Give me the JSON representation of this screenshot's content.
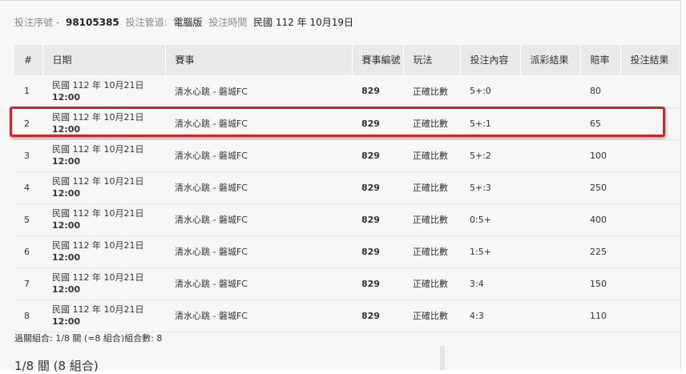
{
  "bet_info": {
    "serial_label": "投注序號 -",
    "serial_value": "98105385",
    "channel_label": "投注管道:",
    "channel_value": "電腦版",
    "time_label": "投注時間",
    "time_value": "民國 112 年 10月19日"
  },
  "table": {
    "headers": [
      "#",
      "日期",
      "賽事",
      "賽事編號",
      "玩法",
      "投注內容",
      "派彩結果",
      "賠率",
      "投注結果"
    ],
    "rows": [
      {
        "no": "1",
        "date": "民國 112 年 10月21日",
        "time": "12:00",
        "match": "清水心跳 - 磐城FC",
        "match_id": "829",
        "play": "正確比數",
        "selection": "5+:0",
        "payout": "",
        "odds": "80",
        "result": ""
      },
      {
        "no": "2",
        "date": "民國 112 年 10月21日",
        "time": "12:00",
        "match": "清水心跳 - 磐城FC",
        "match_id": "829",
        "play": "正確比數",
        "selection": "5+:1",
        "payout": "",
        "odds": "65",
        "result": ""
      },
      {
        "no": "3",
        "date": "民國 112 年 10月21日",
        "time": "12:00",
        "match": "清水心跳 - 磐城FC",
        "match_id": "829",
        "play": "正確比數",
        "selection": "5+:2",
        "payout": "",
        "odds": "100",
        "result": ""
      },
      {
        "no": "4",
        "date": "民國 112 年 10月21日",
        "time": "12:00",
        "match": "清水心跳 - 磐城FC",
        "match_id": "829",
        "play": "正確比數",
        "selection": "5+:3",
        "payout": "",
        "odds": "250",
        "result": ""
      },
      {
        "no": "5",
        "date": "民國 112 年 10月21日",
        "time": "12:00",
        "match": "清水心跳 - 磐城FC",
        "match_id": "829",
        "play": "正確比數",
        "selection": "0:5+",
        "payout": "",
        "odds": "400",
        "result": ""
      },
      {
        "no": "6",
        "date": "民國 112 年 10月21日",
        "time": "12:00",
        "match": "清水心跳 - 磐城FC",
        "match_id": "829",
        "play": "正確比數",
        "selection": "1:5+",
        "payout": "",
        "odds": "225",
        "result": ""
      },
      {
        "no": "7",
        "date": "民國 112 年 10月21日",
        "time": "12:00",
        "match": "清水心跳 - 磐城FC",
        "match_id": "829",
        "play": "正確比數",
        "selection": "3:4",
        "payout": "",
        "odds": "150",
        "result": ""
      },
      {
        "no": "8",
        "date": "民國 112 年 10月21日",
        "time": "12:00",
        "match": "清水心跳 - 磐城FC",
        "match_id": "829",
        "play": "正確比數",
        "selection": "4:3",
        "payout": "",
        "odds": "110",
        "result": ""
      }
    ]
  },
  "parlay": {
    "summary": "過關組合: 1/8 關 (=8 組合)組合數: 8",
    "combo_title": "1/8 關 (8 組合)"
  },
  "colors": {
    "highlight_border": "#d0262a",
    "header_bg": "#e9e9e9",
    "page_bg": "#f7f7f7"
  }
}
